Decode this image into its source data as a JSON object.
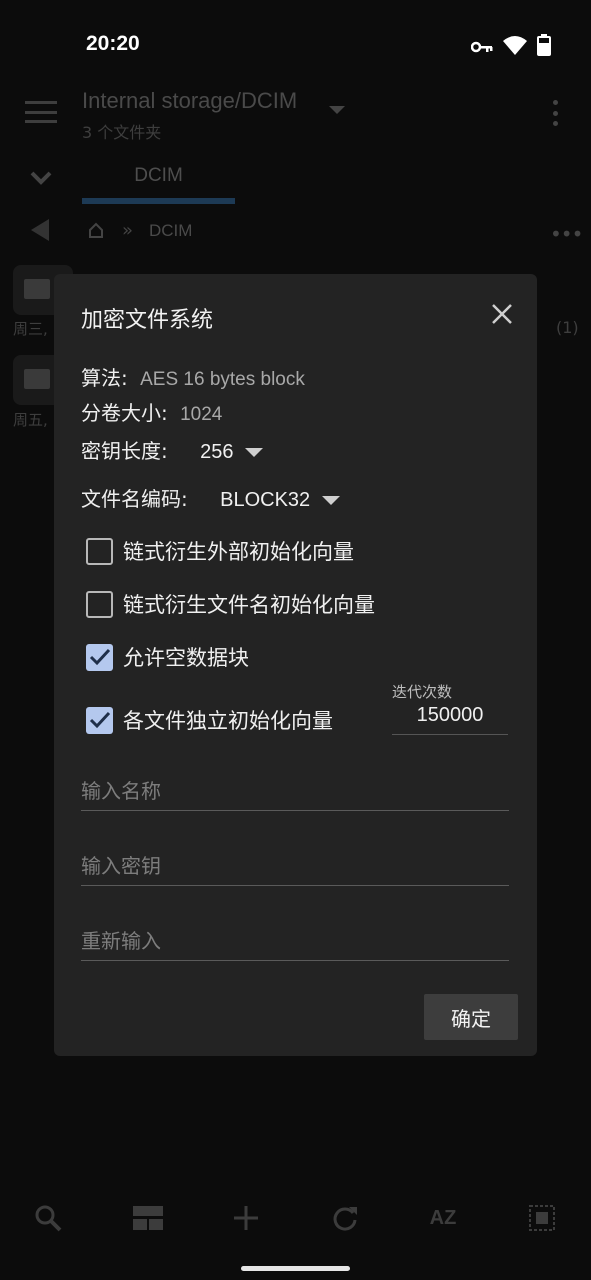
{
  "status": {
    "time": "20:20"
  },
  "app": {
    "path_title": "Internal storage/DCIM",
    "path_subtitle": "3 个文件夹",
    "tab_label": "DCIM",
    "breadcrumb_current": "DCIM",
    "breadcrumb_separator": "»",
    "tile1_date": "周三,",
    "tile2_date": "周五,",
    "tile_count": "(1)",
    "bottom_bar": [
      "search-icon",
      "grid-view-icon",
      "add-icon",
      "refresh-icon",
      "sort-az-icon",
      "select-all-icon"
    ],
    "sort_label": "AZ"
  },
  "dialog": {
    "title": "加密文件系统",
    "algorithm_label": "算法:",
    "algorithm_value": "AES 16 bytes block",
    "volume_size_label": "分卷大小:",
    "volume_size_value": "1024",
    "key_length_label": "密钥长度:",
    "key_length_value": "256",
    "filename_encoding_label": "文件名编码:",
    "filename_encoding_value": "BLOCK32",
    "checkboxes": [
      {
        "label": "链式衍生外部初始化向量",
        "checked": false
      },
      {
        "label": "链式衍生文件名初始化向量",
        "checked": false
      },
      {
        "label": "允许空数据块",
        "checked": true
      },
      {
        "label": "各文件独立初始化向量",
        "checked": true
      }
    ],
    "iterations_label": "迭代次数",
    "iterations_value": "150000",
    "name_placeholder": "输入名称",
    "password_placeholder": "输入密钥",
    "confirm_placeholder": "重新输入",
    "ok_label": "确定",
    "accent_color": "#b4c8ee"
  }
}
